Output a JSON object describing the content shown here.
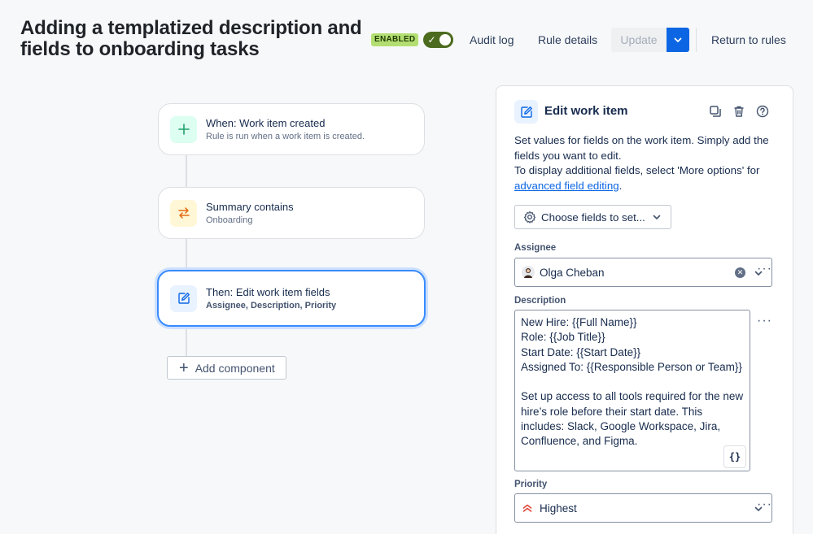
{
  "header": {
    "title": "Adding a templatized description and fields to onboarding tasks",
    "status_badge": "ENABLED",
    "audit_log": "Audit log",
    "rule_details": "Rule details",
    "update": "Update",
    "return_to_rules": "Return to rules"
  },
  "flow": {
    "trigger": {
      "title": "When: Work item created",
      "subtitle": "Rule is run when a work item is created."
    },
    "condition": {
      "title": "Summary contains",
      "subtitle": "Onboarding"
    },
    "action": {
      "title": "Then: Edit work item fields",
      "subtitle": "Assignee, Description, Priority"
    },
    "add_component": "Add component"
  },
  "panel": {
    "title": "Edit work item",
    "description_line1": "Set values for fields on the work item. Simply add the fields you want to edit.",
    "description_line2": "To display additional fields, select 'More options' for",
    "advanced_link": "advanced field editing",
    "choose_fields": "Choose fields to set...",
    "assignee_label": "Assignee",
    "assignee_value": "Olga Cheban",
    "description_label": "Description",
    "description_value": "New Hire: {{Full Name}}\nRole: {{Job Title}}\nStart Date: {{Start Date}}\nAssigned To: {{Responsible Person or Team}}\n\nSet up access to all tools required for the new hire’s role before their start date. This includes: Slack, Google Workspace, Jira, Confluence, and Figma.",
    "braces": "{}",
    "priority_label": "Priority",
    "priority_value": "Highest",
    "more": "···"
  },
  "colors": {
    "accent": "#0c66e4",
    "enabled_bg": "#b3df72",
    "toggle_on": "#4c6b1f",
    "priority_highest": "#e2483d"
  }
}
